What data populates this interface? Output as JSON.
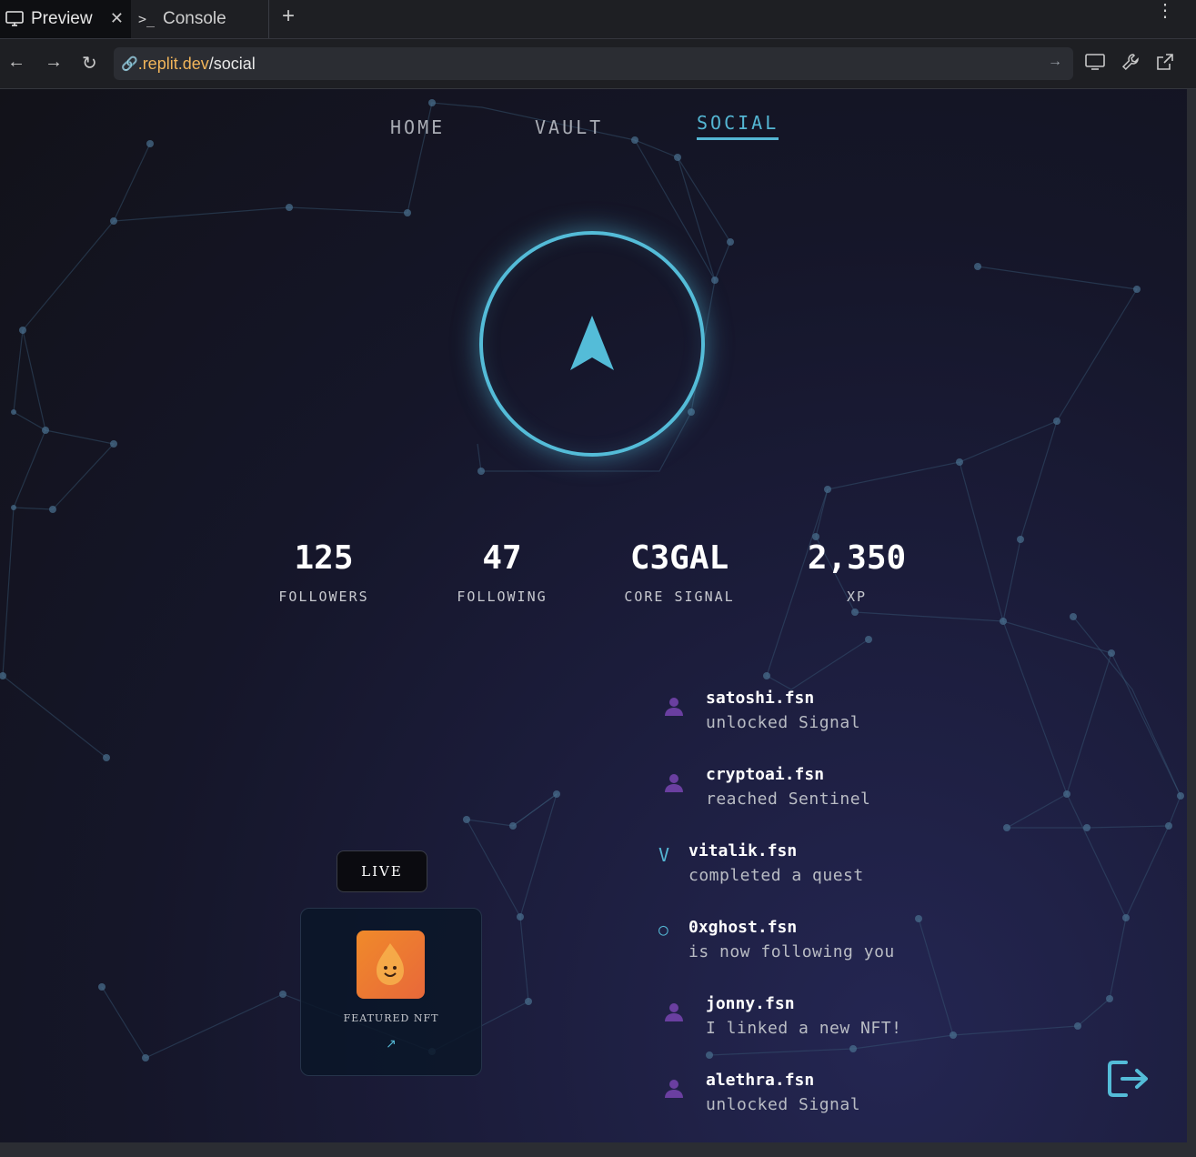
{
  "browser": {
    "tabs": [
      {
        "label": "Preview",
        "icon": "monitor-icon",
        "active": true
      },
      {
        "label": "Console",
        "icon": "terminal-icon",
        "active": false
      }
    ],
    "url": {
      "domain": ".replit.dev",
      "path": "/social"
    }
  },
  "nav": {
    "items": [
      "HOME",
      "VAULT",
      "SOCIAL"
    ],
    "active": "SOCIAL"
  },
  "stats": [
    {
      "value": "125",
      "label": "FOLLOWERS"
    },
    {
      "value": "47",
      "label": "FOLLOWING"
    },
    {
      "value": "C3GAL",
      "label": "CORE SIGNAL"
    },
    {
      "value": "2,350",
      "label": "XP"
    }
  ],
  "live_label": "LIVE",
  "featured": {
    "label": "FEATURED NFT",
    "arrow": "↗"
  },
  "activity": [
    {
      "user": "satoshi.fsn",
      "text": "unlocked Signal",
      "icon": "user-avatar-icon"
    },
    {
      "user": "cryptoai.fsn",
      "text": "reached Sentinel",
      "icon": "user-avatar-icon"
    },
    {
      "user": "vitalik.fsn",
      "text": "completed a quest",
      "glyph": "V"
    },
    {
      "user": "0xghost.fsn",
      "text": "is now following you",
      "glyph": "○"
    },
    {
      "user": "jonny.fsn",
      "text": "I linked a new NFT!",
      "icon": "user-avatar-icon"
    },
    {
      "user": "alethra.fsn",
      "text": "unlocked Signal",
      "icon": "user-avatar-icon"
    }
  ],
  "colors": {
    "accent": "#54b6d3",
    "avatar": "#6a3fa0",
    "nft": "#f08a2a"
  }
}
